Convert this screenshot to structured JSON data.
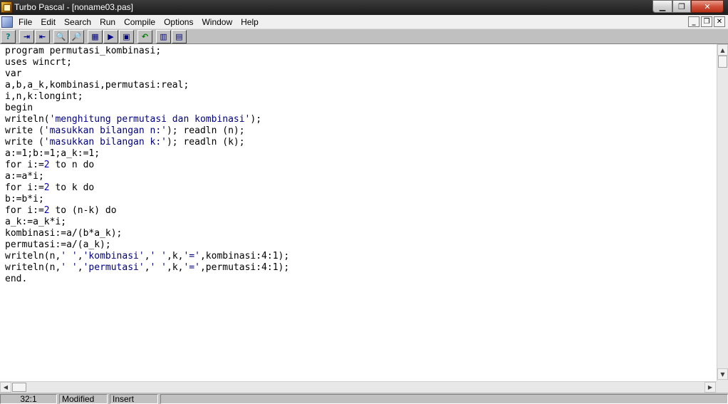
{
  "window": {
    "title": "Turbo Pascal - [noname03.pas]"
  },
  "menu": {
    "items": [
      "File",
      "Edit",
      "Search",
      "Run",
      "Compile",
      "Options",
      "Window",
      "Help"
    ]
  },
  "mdi_controls": {
    "minimize": "_",
    "restore": "❐",
    "close": "✕"
  },
  "toolbar": {
    "buttons": [
      {
        "name": "help-icon",
        "glyph": "?"
      },
      {
        "name": "open-file-icon",
        "glyph": "⇥"
      },
      {
        "name": "save-file-icon",
        "glyph": "⇤"
      },
      {
        "name": "find-icon",
        "glyph": "🔍"
      },
      {
        "name": "find-next-icon",
        "glyph": "🔎"
      },
      {
        "name": "compile-icon",
        "glyph": "▦"
      },
      {
        "name": "make-icon",
        "glyph": "▶"
      },
      {
        "name": "run-icon",
        "glyph": "▣"
      },
      {
        "name": "undo-icon",
        "glyph": "↶"
      },
      {
        "name": "build-icon",
        "glyph": "▥"
      },
      {
        "name": "binary-icon",
        "glyph": "▤"
      }
    ]
  },
  "editor": {
    "lines": [
      [
        {
          "t": "program permutasi_kombinasi;"
        }
      ],
      [
        {
          "t": "uses wincrt;"
        }
      ],
      [
        {
          "t": "var"
        }
      ],
      [
        {
          "t": "a,b,a_k,kombinasi,permutasi:real;"
        }
      ],
      [
        {
          "t": "i,n,k:longint;"
        }
      ],
      [
        {
          "t": "begin"
        }
      ],
      [
        {
          "t": "writeln("
        },
        {
          "t": "'menghitung permutasi dan kombinasi'",
          "c": "str"
        },
        {
          "t": ");"
        }
      ],
      [
        {
          "t": "write ("
        },
        {
          "t": "'masukkan bilangan n:'",
          "c": "str"
        },
        {
          "t": "); readln (n);"
        }
      ],
      [
        {
          "t": "write ("
        },
        {
          "t": "'masukkan bilangan k:'",
          "c": "str"
        },
        {
          "t": "); readln (k);"
        }
      ],
      [
        {
          "t": "a:=1;b:=1;a_k:=1;"
        }
      ],
      [
        {
          "t": "for i:="
        },
        {
          "t": "2",
          "c": "num"
        },
        {
          "t": " to n do"
        }
      ],
      [
        {
          "t": "a:=a*i;"
        }
      ],
      [
        {
          "t": "for i:="
        },
        {
          "t": "2",
          "c": "num"
        },
        {
          "t": " to k do"
        }
      ],
      [
        {
          "t": "b:=b*i;"
        }
      ],
      [
        {
          "t": "for i:="
        },
        {
          "t": "2",
          "c": "num"
        },
        {
          "t": " to (n-k) do"
        }
      ],
      [
        {
          "t": "a_k:=a_k*i;"
        }
      ],
      [
        {
          "t": "kombinasi:=a/(b*a_k);"
        }
      ],
      [
        {
          "t": "permutasi:=a/(a_k);"
        }
      ],
      [
        {
          "t": "writeln(n,"
        },
        {
          "t": "' '",
          "c": "str"
        },
        {
          "t": ","
        },
        {
          "t": "'kombinasi'",
          "c": "str"
        },
        {
          "t": ","
        },
        {
          "t": "' '",
          "c": "str"
        },
        {
          "t": ",k,"
        },
        {
          "t": "'='",
          "c": "str"
        },
        {
          "t": ",kombinasi:4:1);"
        }
      ],
      [
        {
          "t": "writeln(n,"
        },
        {
          "t": "' '",
          "c": "str"
        },
        {
          "t": ","
        },
        {
          "t": "'permutasi'",
          "c": "str"
        },
        {
          "t": ","
        },
        {
          "t": "' '",
          "c": "str"
        },
        {
          "t": ",k,"
        },
        {
          "t": "'='",
          "c": "str"
        },
        {
          "t": ",permutasi:4:1);"
        }
      ],
      [
        {
          "t": "end."
        }
      ]
    ]
  },
  "status": {
    "position": "32:1",
    "modified": "Modified",
    "mode": "Insert",
    "message": ""
  },
  "colors": {
    "string": "#000080",
    "number": "#0000c0",
    "editor_bg": "#ffffff",
    "chrome": "#c0c0c0"
  }
}
